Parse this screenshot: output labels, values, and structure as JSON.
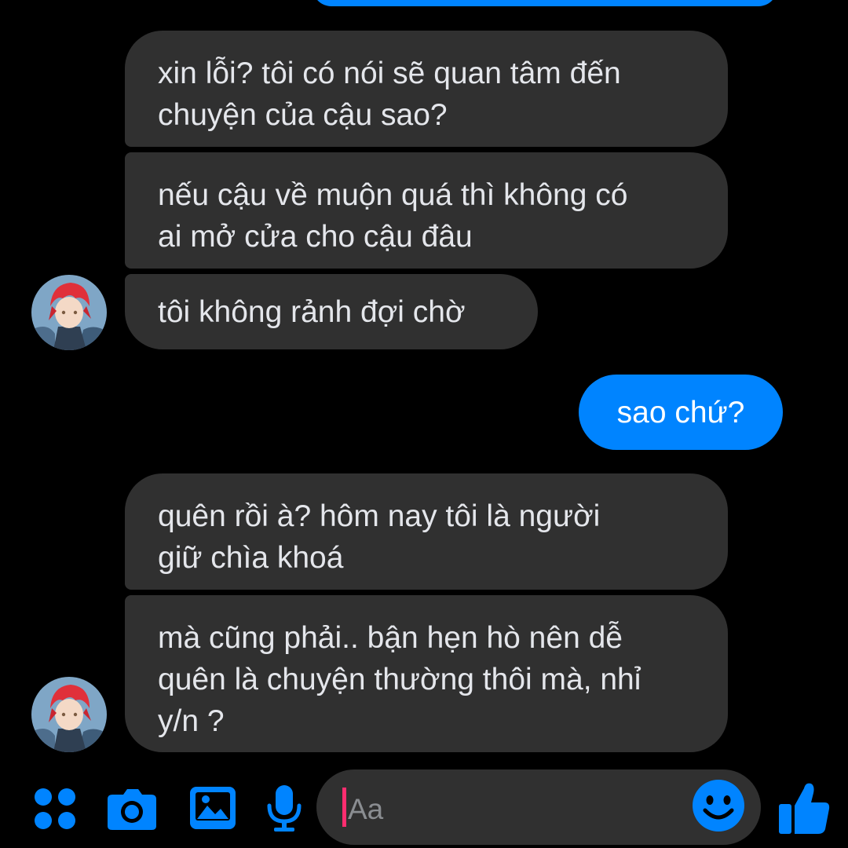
{
  "colors": {
    "background": "#000000",
    "received_bubble": "#303030",
    "sent_bubble": "#0084ff",
    "accent": "#0084ff",
    "caret": "#ff2d6f"
  },
  "messages": [
    {
      "direction": "received",
      "text": "xin lỗi? tôi có nói sẽ quan tâm đến\nchuyện của cậu sao?"
    },
    {
      "direction": "received",
      "text": "nếu cậu về muộn quá thì không có\nai mở cửa cho cậu đâu"
    },
    {
      "direction": "received",
      "text": "tôi không rảnh đợi chờ"
    },
    {
      "direction": "sent",
      "text": "sao chứ?"
    },
    {
      "direction": "received",
      "text": "quên rồi à? hôm nay tôi là người\ngiữ chìa khoá"
    },
    {
      "direction": "received",
      "text": "mà cũng phải.. bận hẹn hò nên dễ\nquên là chuyện thường thôi mà, nhỉ\ny/n ?"
    }
  ],
  "composer": {
    "placeholder": "Aa",
    "value": "",
    "icons": [
      "apps-grid-icon",
      "camera-icon",
      "image-icon",
      "microphone-icon",
      "emoji-icon",
      "thumbs-up-icon"
    ]
  }
}
